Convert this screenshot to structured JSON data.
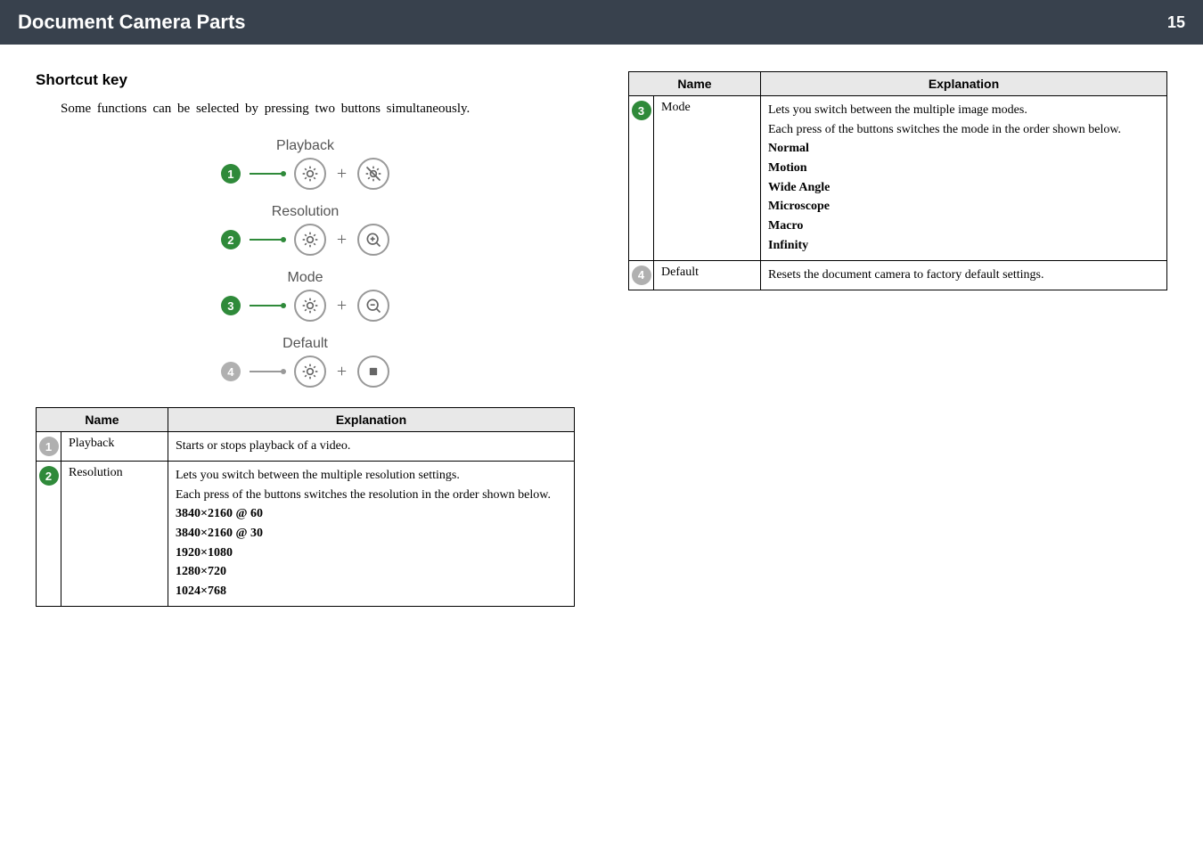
{
  "header": {
    "title": "Document Camera Parts",
    "page": "15"
  },
  "section": {
    "heading": "Shortcut  key",
    "intro": "Some  functions  can  be  selected  by  pressing  two  buttons  simultaneously."
  },
  "shortcuts": [
    {
      "num": "1",
      "label": "Playback",
      "icon_a": "sun",
      "icon_b": "sun-cross"
    },
    {
      "num": "2",
      "label": "Resolution",
      "icon_a": "sun",
      "icon_b": "zoom-in"
    },
    {
      "num": "3",
      "label": "Mode",
      "icon_a": "sun",
      "icon_b": "zoom-out"
    },
    {
      "num": "4",
      "label": "Default",
      "icon_a": "sun",
      "icon_b": "stop"
    }
  ],
  "tableL": {
    "headers": [
      "Name",
      "Explanation"
    ],
    "rows": [
      {
        "num": "1",
        "name": "Playback",
        "exp": [
          "Starts or stops playback of a video."
        ]
      },
      {
        "num": "2",
        "name": "Resolution",
        "exp": [
          "Lets you switch between the multiple resolution settings.",
          "Each press of the buttons switches the resolution in the order shown below."
        ],
        "bold": [
          "3840×2160 @ 60",
          "3840×2160 @ 30",
          "1920×1080",
          "1280×720",
          "1024×768"
        ]
      }
    ]
  },
  "tableR": {
    "headers": [
      "Name",
      "Explanation"
    ],
    "rows": [
      {
        "num": "3",
        "name": "Mode",
        "exp": [
          "Lets you switch between the multiple image modes.",
          "Each press of the buttons switches the mode in the order shown below."
        ],
        "bold": [
          "Normal",
          "Motion",
          "Wide Angle",
          "Microscope",
          "Macro",
          "Infinity"
        ]
      },
      {
        "num": "4",
        "name": "Default",
        "exp": [
          "Resets the document camera to factory default settings."
        ]
      }
    ]
  }
}
